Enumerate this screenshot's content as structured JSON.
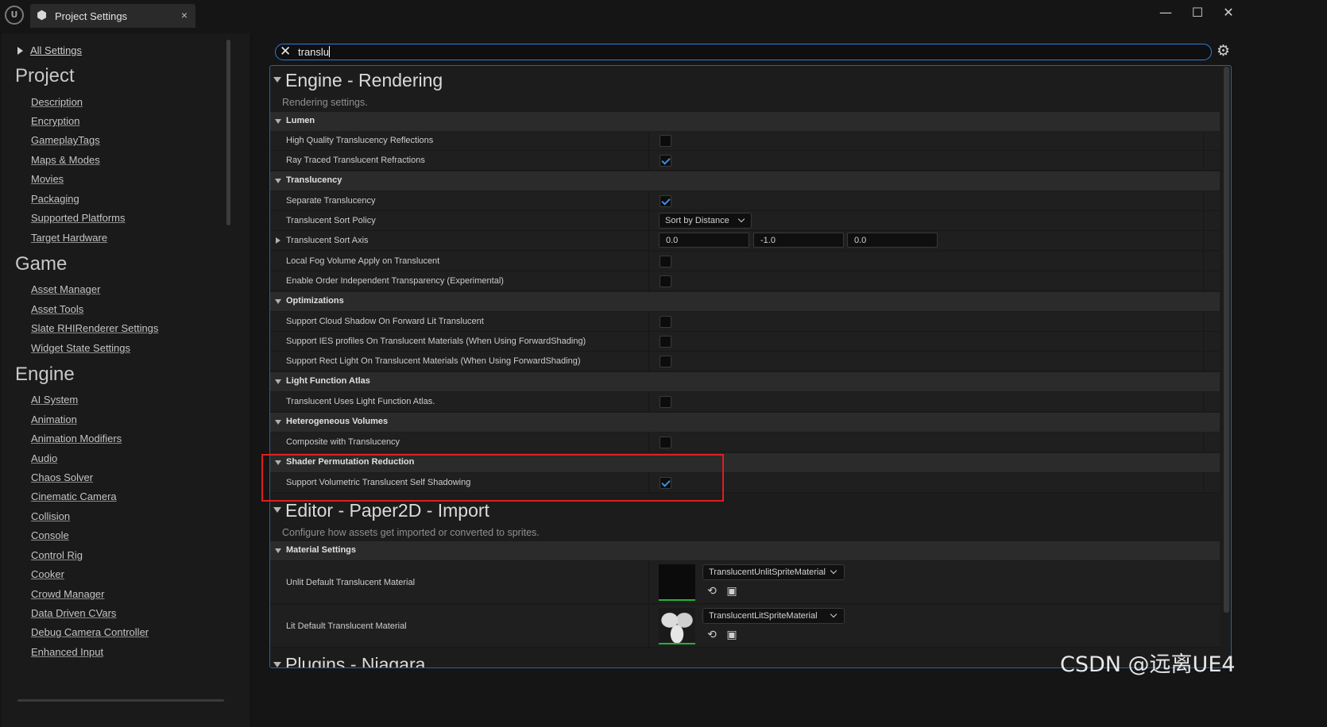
{
  "window": {
    "logo_text": "U",
    "tab_title": "Project Settings",
    "tab_icon": "settings-cube-icon",
    "close_symbol": "×",
    "minimize_symbol": "—",
    "maximize_symbol": "☐",
    "win_close_symbol": "✕"
  },
  "sidebar": {
    "all_settings": "All Settings",
    "groups": [
      {
        "heading": "Project",
        "items": [
          "Description",
          "Encryption",
          "GameplayTags",
          "Maps & Modes",
          "Movies",
          "Packaging",
          "Supported Platforms",
          "Target Hardware"
        ]
      },
      {
        "heading": "Game",
        "items": [
          "Asset Manager",
          "Asset Tools",
          "Slate RHIRenderer Settings",
          "Widget State Settings"
        ]
      },
      {
        "heading": "Engine",
        "items": [
          "AI System",
          "Animation",
          "Animation Modifiers",
          "Audio",
          "Chaos Solver",
          "Cinematic Camera",
          "Collision",
          "Console",
          "Control Rig",
          "Cooker",
          "Crowd Manager",
          "Data Driven CVars",
          "Debug Camera Controller",
          "Enhanced Input"
        ]
      }
    ]
  },
  "search": {
    "value": "translu",
    "clear_icon": "close-icon",
    "settings_icon": "gear-icon"
  },
  "sections": [
    {
      "title": "Engine - Rendering",
      "description": "Rendering settings.",
      "categories": [
        {
          "name": "Lumen",
          "rows": [
            {
              "label": "High Quality Translucency Reflections",
              "type": "checkbox",
              "checked": false
            },
            {
              "label": "Ray Traced Translucent Refractions",
              "type": "checkbox",
              "checked": true
            }
          ]
        },
        {
          "name": "Translucency",
          "rows": [
            {
              "label": "Separate Translucency",
              "type": "checkbox",
              "checked": true
            },
            {
              "label": "Translucent Sort Policy",
              "type": "combo",
              "value": "Sort by Distance"
            },
            {
              "label": "Translucent Sort Axis",
              "type": "vector",
              "values": [
                "0.0",
                "-1.0",
                "0.0"
              ]
            },
            {
              "label": "Local Fog Volume Apply on Translucent",
              "type": "checkbox",
              "checked": false
            },
            {
              "label": "Enable Order Independent Transparency (Experimental)",
              "type": "checkbox",
              "checked": false
            }
          ]
        },
        {
          "name": "Optimizations",
          "rows": [
            {
              "label": "Support Cloud Shadow On Forward Lit Translucent",
              "type": "checkbox",
              "checked": false
            },
            {
              "label": "Support IES profiles On Translucent Materials (When Using ForwardShading)",
              "type": "checkbox",
              "checked": false
            },
            {
              "label": "Support Rect Light On Translucent Materials (When Using ForwardShading)",
              "type": "checkbox",
              "checked": false
            }
          ]
        },
        {
          "name": "Light Function Atlas",
          "rows": [
            {
              "label": "Translucent Uses Light Function Atlas.",
              "type": "checkbox",
              "checked": false
            }
          ]
        },
        {
          "name": "Heterogeneous Volumes",
          "rows": [
            {
              "label": "Composite with Translucency",
              "type": "checkbox",
              "checked": false
            }
          ]
        },
        {
          "name": "Shader Permutation Reduction",
          "rows": [
            {
              "label": "Support Volumetric Translucent Self Shadowing",
              "type": "checkbox",
              "checked": true
            }
          ]
        }
      ]
    },
    {
      "title": "Editor - Paper2D - Import",
      "description": "Configure how assets get imported or converted to sprites.",
      "categories": [
        {
          "name": "Material Settings",
          "rows": [
            {
              "label": "Unlit Default Translucent Material",
              "type": "asset",
              "value": "TranslucentUnlitSpriteMaterial"
            },
            {
              "label": "Lit Default Translucent Material",
              "type": "asset",
              "value": "TranslucentLitSpriteMaterial"
            }
          ]
        }
      ]
    },
    {
      "title": "Plugins - Niagara"
    }
  ],
  "watermark": "CSDN @远离UE4"
}
